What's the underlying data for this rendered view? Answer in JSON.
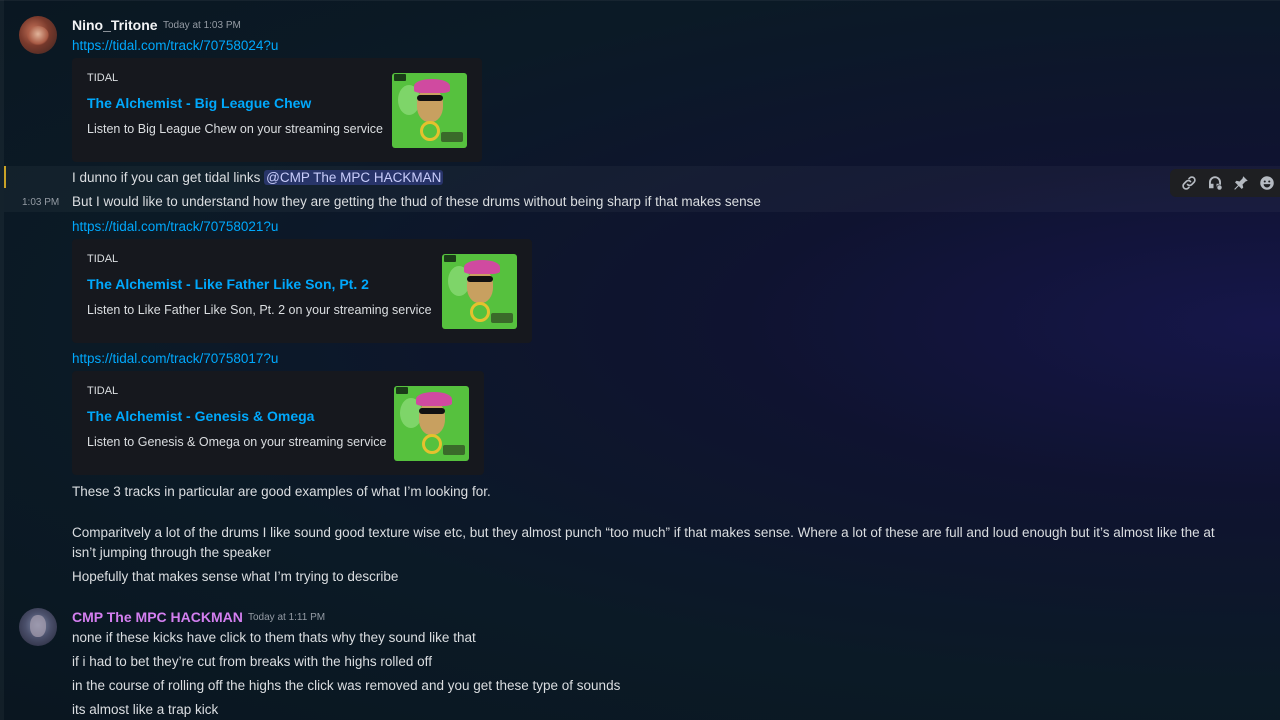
{
  "messages": {
    "nino": {
      "username": "Nino_Tritone",
      "timestamp": "Today at 1:03 PM",
      "side_time": "1:03 PM",
      "link1": "https://tidal.com/track/70758024?u",
      "embed1": {
        "provider": "TIDAL",
        "title": "The Alchemist - Big League Chew",
        "description": "Listen to Big League Chew on your streaming service"
      },
      "line_mention_prefix": "I dunno if you can get tidal links ",
      "mention": "@CMP The MPC HACKMAN",
      "line2": "But I would like to understand how they are getting the thud of these drums without being sharp if that makes sense",
      "link2": "https://tidal.com/track/70758021?u",
      "embed2": {
        "provider": "TIDAL",
        "title": "The Alchemist - Like Father Like Son, Pt. 2",
        "description": "Listen to Like Father Like Son, Pt. 2 on your streaming service"
      },
      "link3": "https://tidal.com/track/70758017?u",
      "embed3": {
        "provider": "TIDAL",
        "title": "The Alchemist - Genesis & Omega",
        "description": "Listen to Genesis & Omega on your streaming service"
      },
      "line3": "These 3 tracks in particular are good examples of what I’m looking for.",
      "line4": "Comparitvely a lot of the drums I like sound good texture wise etc, but they almost punch “too much” if that makes sense. Where a lot of these are full and loud enough but it’s almost like the at",
      "line5": "isn’t jumping through the speaker",
      "line6": "Hopefully that makes sense what I’m trying to describe"
    },
    "cmp": {
      "username": "CMP The MPC HACKMAN",
      "timestamp": "Today at 1:11 PM",
      "line1": "none if these kicks have click to them thats why they sound like that",
      "line2": "if i had to bet they’re cut from breaks with the highs rolled off",
      "line3": "in the course of rolling off the highs the click was removed and you get these type of sounds",
      "line4": "its almost like a trap kick"
    }
  },
  "toolbar": {
    "icons": [
      "link-icon",
      "thread-icon",
      "pin-icon",
      "emoji-icon"
    ]
  },
  "colors": {
    "link": "#00a8fc",
    "cmp_name": "#d47ff0",
    "mention_bg": "#3a3f8a",
    "album_green": "#56c13e"
  }
}
